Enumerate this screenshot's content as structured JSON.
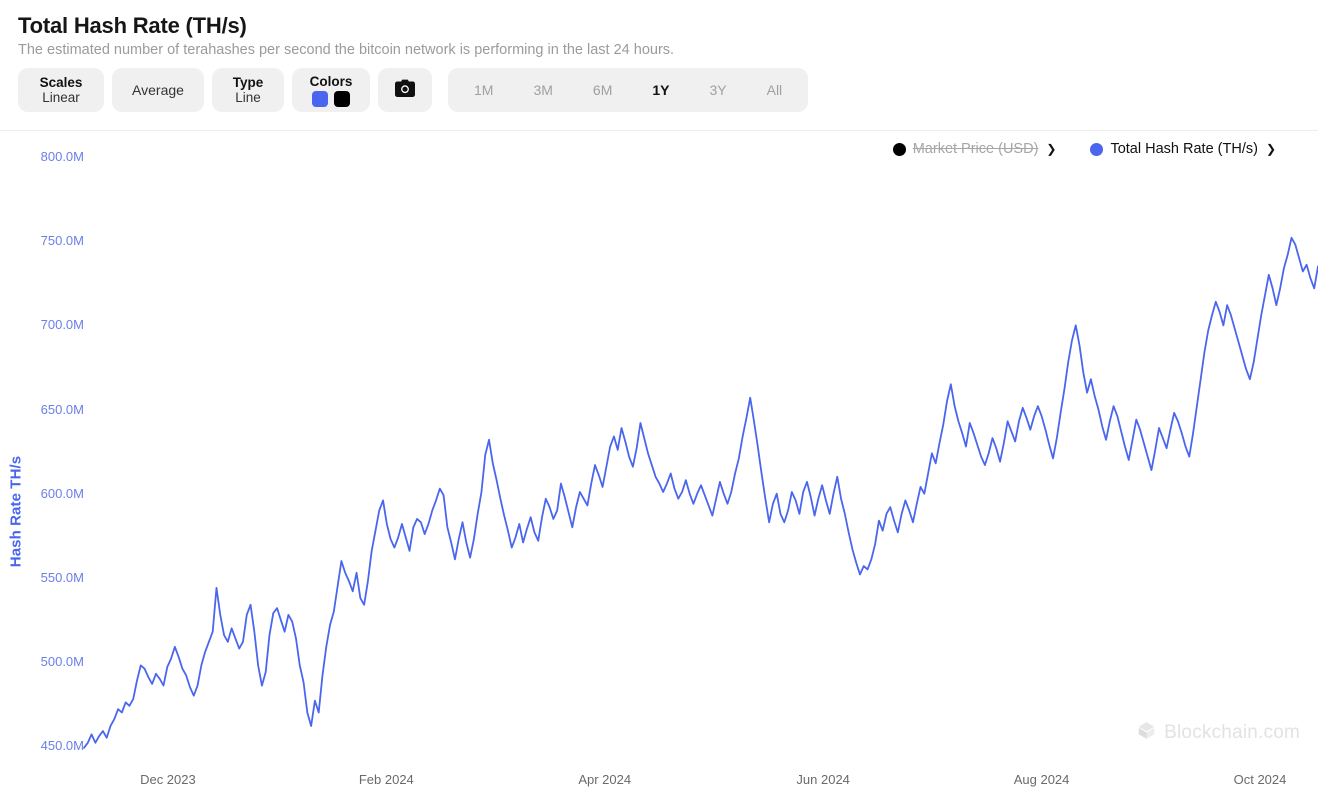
{
  "header": {
    "title": "Total Hash Rate (TH/s)",
    "subtitle": "The estimated number of terahashes per second the bitcoin network is performing in the last 24 hours."
  },
  "toolbar": {
    "scales": {
      "title": "Scales",
      "value": "Linear"
    },
    "average": {
      "value": "Average"
    },
    "type": {
      "title": "Type",
      "value": "Line"
    },
    "colors": {
      "title": "Colors",
      "primary": "#4a66ee",
      "secondary": "#000000"
    },
    "camera": {
      "icon": "camera-icon"
    },
    "ranges": [
      {
        "label": "1M",
        "active": false
      },
      {
        "label": "3M",
        "active": false
      },
      {
        "label": "6M",
        "active": false
      },
      {
        "label": "1Y",
        "active": true
      },
      {
        "label": "3Y",
        "active": false
      },
      {
        "label": "All",
        "active": false
      }
    ]
  },
  "legend": [
    {
      "label": "Market Price (USD)",
      "color": "#000000",
      "disabled": true
    },
    {
      "label": "Total Hash Rate (TH/s)",
      "color": "#4a66ee",
      "disabled": false
    }
  ],
  "watermark": {
    "text": "Blockchain.com"
  },
  "chart_data": {
    "type": "line",
    "title": "Total Hash Rate (TH/s)",
    "subtitle": "The estimated number of terahashes per second the bitcoin network is performing in the last 24 hours.",
    "xlabel": "",
    "ylabel": "Hash Rate TH/s",
    "ylim": [
      440,
      800
    ],
    "ytick_values": [
      450,
      500,
      550,
      600,
      650,
      700,
      750,
      800
    ],
    "ytick_labels": [
      "450.0M",
      "500.0M",
      "550.0M",
      "600.0M",
      "650.0M",
      "700.0M",
      "750.0M",
      "800.0M"
    ],
    "xtick_labels": [
      "Dec 2023",
      "Feb 2024",
      "Apr 2024",
      "Jun 2024",
      "Aug 2024",
      "Oct 2024"
    ],
    "xtick_positions": [
      0.068,
      0.245,
      0.422,
      0.599,
      0.776,
      0.953
    ],
    "grid": false,
    "legend_position": "top-right",
    "units": "M",
    "series": [
      {
        "name": "Total Hash Rate (TH/s)",
        "color": "#4a66ee",
        "values": [
          449,
          452,
          457,
          452,
          456,
          459,
          455,
          462,
          466,
          472,
          470,
          476,
          474,
          478,
          489,
          498,
          496,
          491,
          487,
          493,
          490,
          486,
          497,
          502,
          509,
          503,
          496,
          492,
          485,
          480,
          486,
          498,
          506,
          512,
          518,
          544,
          528,
          516,
          512,
          520,
          514,
          508,
          512,
          528,
          534,
          518,
          498,
          486,
          494,
          516,
          529,
          532,
          525,
          518,
          528,
          524,
          514,
          498,
          488,
          470,
          462,
          477,
          470,
          492,
          509,
          522,
          530,
          545,
          560,
          553,
          548,
          542,
          553,
          538,
          534,
          548,
          566,
          578,
          590,
          596,
          582,
          573,
          568,
          574,
          582,
          574,
          566,
          580,
          585,
          583,
          576,
          582,
          590,
          596,
          603,
          599,
          580,
          571,
          561,
          573,
          583,
          571,
          562,
          573,
          588,
          601,
          623,
          632,
          618,
          608,
          597,
          587,
          578,
          568,
          574,
          582,
          571,
          579,
          586,
          577,
          572,
          586,
          597,
          592,
          585,
          590,
          606,
          598,
          589,
          580,
          592,
          601,
          597,
          593,
          606,
          617,
          611,
          604,
          616,
          628,
          634,
          626,
          639,
          631,
          622,
          616,
          627,
          642,
          633,
          624,
          617,
          610,
          606,
          601,
          606,
          612,
          603,
          597,
          601,
          608,
          600,
          594,
          600,
          605,
          599,
          593,
          587,
          597,
          607,
          600,
          594,
          601,
          612,
          621,
          634,
          645,
          657,
          643,
          628,
          612,
          597,
          583,
          594,
          600,
          588,
          583,
          590,
          601,
          596,
          588,
          601,
          607,
          598,
          587,
          597,
          605,
          596,
          588,
          600,
          610,
          597,
          588,
          577,
          567,
          559,
          552,
          557,
          555,
          561,
          570,
          584,
          578,
          588,
          592,
          584,
          577,
          588,
          596,
          590,
          583,
          594,
          604,
          600,
          612,
          624,
          618,
          630,
          641,
          655,
          665,
          652,
          643,
          636,
          628,
          642,
          636,
          629,
          622,
          617,
          624,
          633,
          627,
          619,
          630,
          643,
          637,
          631,
          643,
          651,
          645,
          638,
          646,
          652,
          646,
          638,
          629,
          621,
          633,
          648,
          662,
          678,
          691,
          700,
          688,
          672,
          660,
          668,
          658,
          650,
          640,
          632,
          643,
          652,
          646,
          637,
          628,
          620,
          632,
          644,
          638,
          630,
          622,
          614,
          626,
          639,
          633,
          627,
          638,
          648,
          643,
          636,
          628,
          622,
          636,
          652,
          668,
          684,
          697,
          706,
          714,
          708,
          700,
          712,
          706,
          698,
          690,
          682,
          674,
          668,
          678,
          692,
          706,
          718,
          730,
          722,
          712,
          722,
          734,
          742,
          752,
          748,
          740,
          732,
          736,
          728,
          722,
          735
        ]
      }
    ]
  }
}
